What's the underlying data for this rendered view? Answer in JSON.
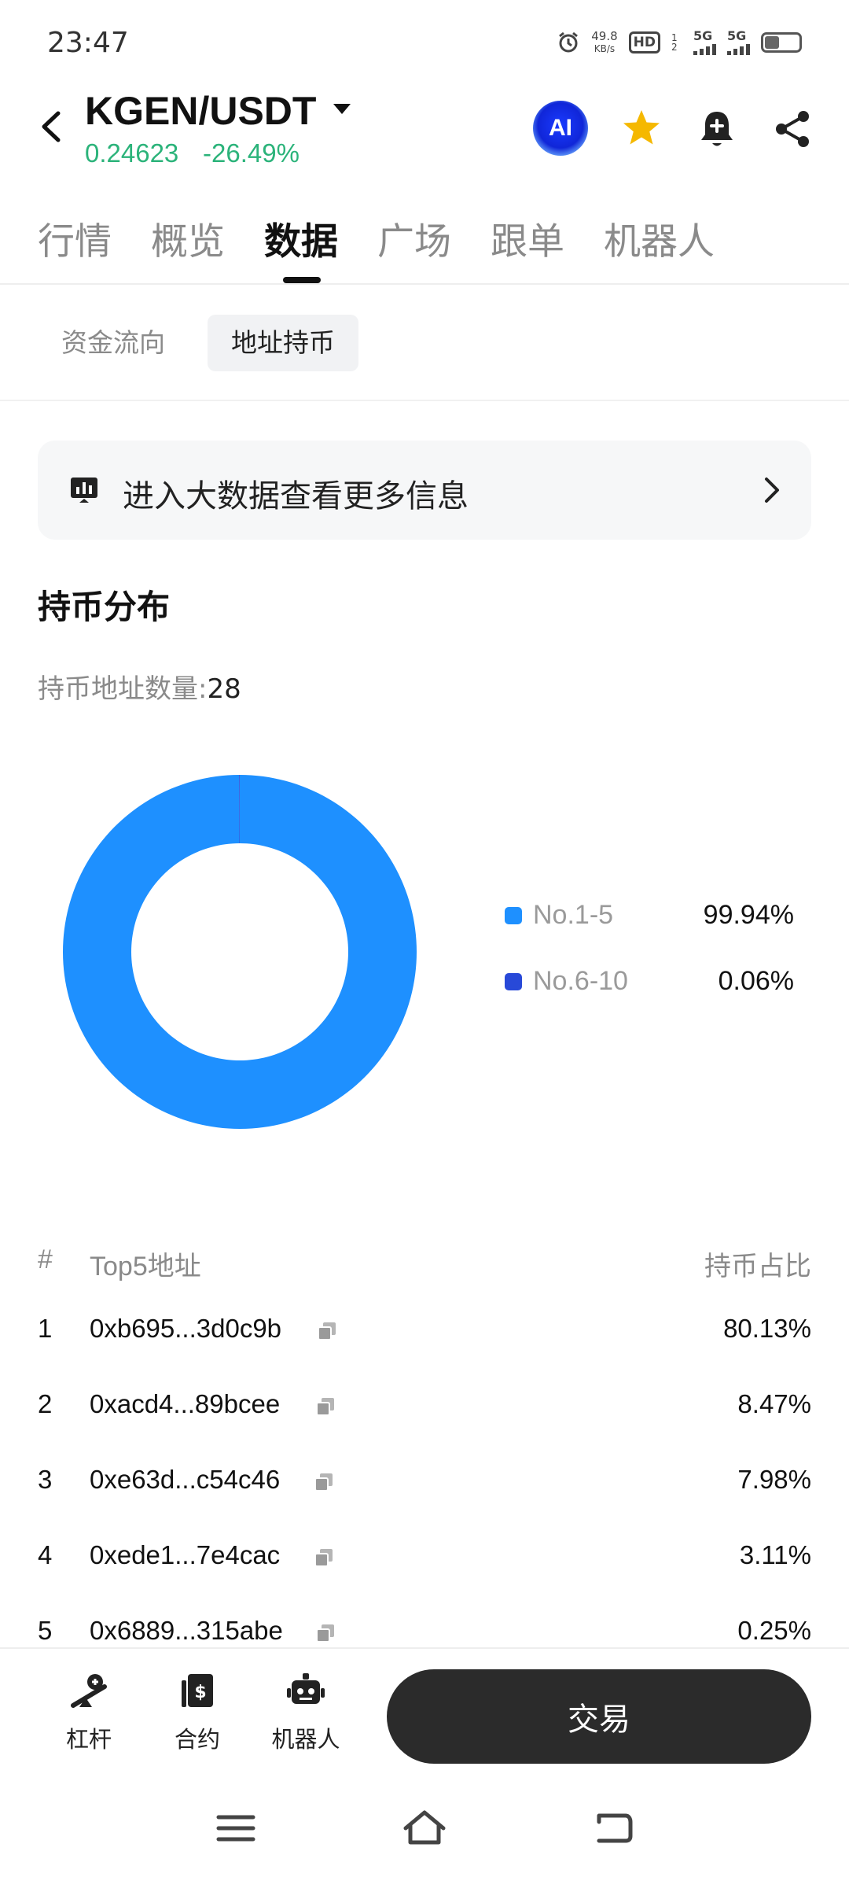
{
  "status_bar": {
    "time": "23:47",
    "net_speed_value": "49.8",
    "net_speed_unit": "KB/s",
    "hd_badge": "HD",
    "hd_sub": "1 2",
    "signal1_label": "5G",
    "signal2_label": "5G",
    "battery_level": 0.4
  },
  "header": {
    "pair": "KGEN/USDT",
    "price": "0.24623",
    "change": "-26.49%",
    "ai_label": "AI",
    "icons": [
      "back-arrow-icon",
      "ai-icon",
      "star-icon",
      "bell-plus-icon",
      "share-icon"
    ],
    "colors": {
      "up_green": "#2bb37a",
      "star": "#f5b800",
      "ai_blue": "#1a3bff"
    }
  },
  "main_tabs": [
    "行情",
    "概览",
    "数据",
    "广场",
    "跟单",
    "机器人"
  ],
  "active_main_tab": "数据",
  "sub_tabs": [
    "资金流向",
    "地址持币"
  ],
  "active_sub_tab": "地址持币",
  "banner": {
    "text": "进入大数据查看更多信息",
    "icon": "chart-monitor-icon"
  },
  "distribution": {
    "title": "持币分布",
    "count_label": "持币地址数量:",
    "count_value": "28"
  },
  "chart_data": {
    "type": "pie",
    "categories": [
      "No.1-5",
      "No.6-10"
    ],
    "values": [
      99.94,
      0.06
    ],
    "value_labels": [
      "99.94%",
      "0.06%"
    ],
    "colors": [
      "#1e90ff",
      "#2849d8"
    ],
    "donut": true,
    "legend_position": "right"
  },
  "table": {
    "headers": {
      "rank": "#",
      "address": "Top5地址",
      "share": "持币占比"
    },
    "rows": [
      {
        "rank": "1",
        "address": "0xb695...3d0c9b",
        "share": "80.13%"
      },
      {
        "rank": "2",
        "address": "0xacd4...89bcee",
        "share": "8.47%"
      },
      {
        "rank": "3",
        "address": "0xe63d...c54c46",
        "share": "7.98%"
      },
      {
        "rank": "4",
        "address": "0xede1...7e4cac",
        "share": "3.11%"
      },
      {
        "rank": "5",
        "address": "0x6889...315abe",
        "share": "0.25%"
      }
    ]
  },
  "bottom_bar": {
    "items": [
      {
        "label": "杠杆",
        "icon": "leverage-icon"
      },
      {
        "label": "合约",
        "icon": "contract-icon"
      },
      {
        "label": "机器人",
        "icon": "robot-icon"
      }
    ],
    "trade_label": "交易"
  },
  "nav_bar": {
    "icons": [
      "menu-icon",
      "home-icon",
      "back-icon"
    ]
  }
}
